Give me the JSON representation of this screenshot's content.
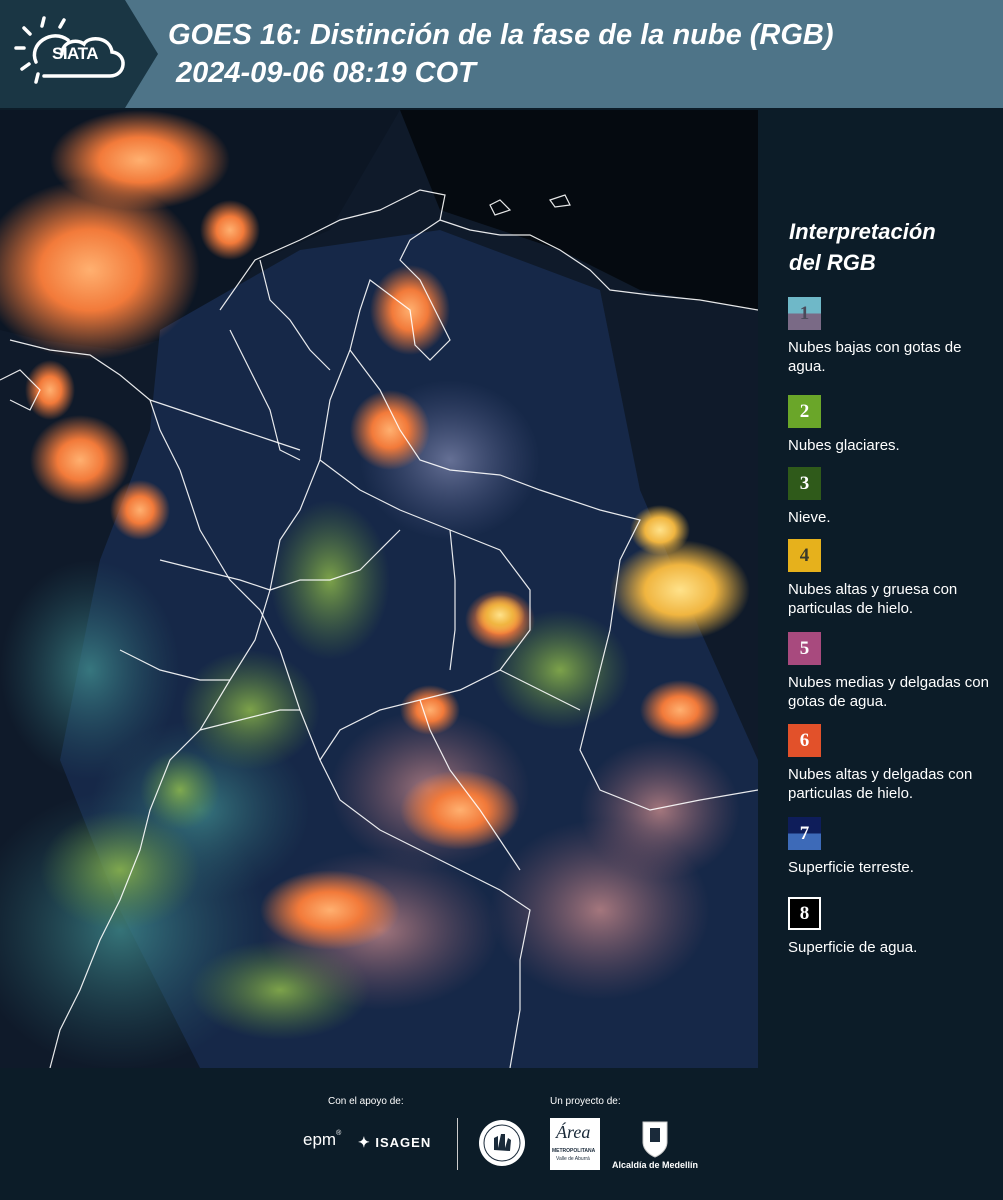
{
  "header": {
    "logo_text": "SIATA",
    "title_line1": "GOES 16: Distinción de la fase de la nube (RGB)",
    "title_line2": "2024-09-06 08:19 COT"
  },
  "legend": {
    "title_line1": "Interpretación",
    "title_line2": "del RGB",
    "items": [
      {
        "num": "1",
        "label": "Nubes bajas con gotas de agua.",
        "top": "#6fb8c8",
        "bottom": "#7a6a86",
        "numColor": "#4a4a5a"
      },
      {
        "num": "2",
        "label": "Nubes glaciares.",
        "top": "#6aa629",
        "bottom": "#6aa629",
        "numColor": "#ffffff"
      },
      {
        "num": "3",
        "label": "Nieve.",
        "top": "#2f5a1a",
        "bottom": "#2f5a1a",
        "numColor": "#ffffff"
      },
      {
        "num": "4",
        "label": "Nubes altas y gruesa con particulas de hielo.",
        "top": "#e6b11c",
        "bottom": "#e6b11c",
        "numColor": "#3a3a2a"
      },
      {
        "num": "5",
        "label": "Nubes medias y delgadas con gotas de agua.",
        "top": "#a84a7e",
        "bottom": "#a84a7e",
        "numColor": "#ffffff"
      },
      {
        "num": "6",
        "label": "Nubes altas y delgadas con particulas de hielo.",
        "top": "#e2512a",
        "bottom": "#e2512a",
        "numColor": "#ffffff"
      },
      {
        "num": "7",
        "label": "Superficie terreste.",
        "top": "#0e1d5a",
        "bottom": "#3d6ab8",
        "numColor": "#ffffff"
      },
      {
        "num": "8",
        "label": "Superficie de agua.",
        "top": "#000000",
        "bottom": "#000000",
        "numColor": "#ffffff"
      }
    ]
  },
  "footer": {
    "support_label": "Con el apoyo de:",
    "project_label": "Un proyecto de:",
    "epm": "epm",
    "isagen": "ISAGEN",
    "area_small": "METROPOLITANA",
    "area_sub": "Valle de Aburrá",
    "area_big": "Área",
    "alcaldia": "Alcaldía de Medellín"
  }
}
